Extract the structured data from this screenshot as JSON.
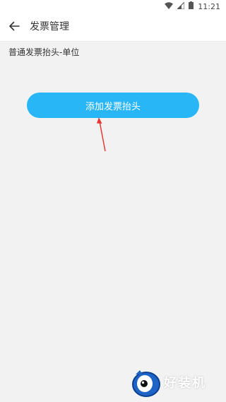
{
  "status_bar": {
    "time": "11:21",
    "icons": [
      "wifi-icon",
      "signal-icon",
      "battery-icon"
    ]
  },
  "toolbar": {
    "title": "发票管理",
    "back_icon": "arrow-left-icon"
  },
  "main": {
    "section_title": "普通发票抬头-单位",
    "add_button_label": "添加发票抬头"
  },
  "annotation": {
    "arrow_color": "#e53935"
  },
  "colors": {
    "accent": "#29b6f6",
    "background": "#f2f2f2"
  },
  "watermark": {
    "text": "好装机"
  }
}
